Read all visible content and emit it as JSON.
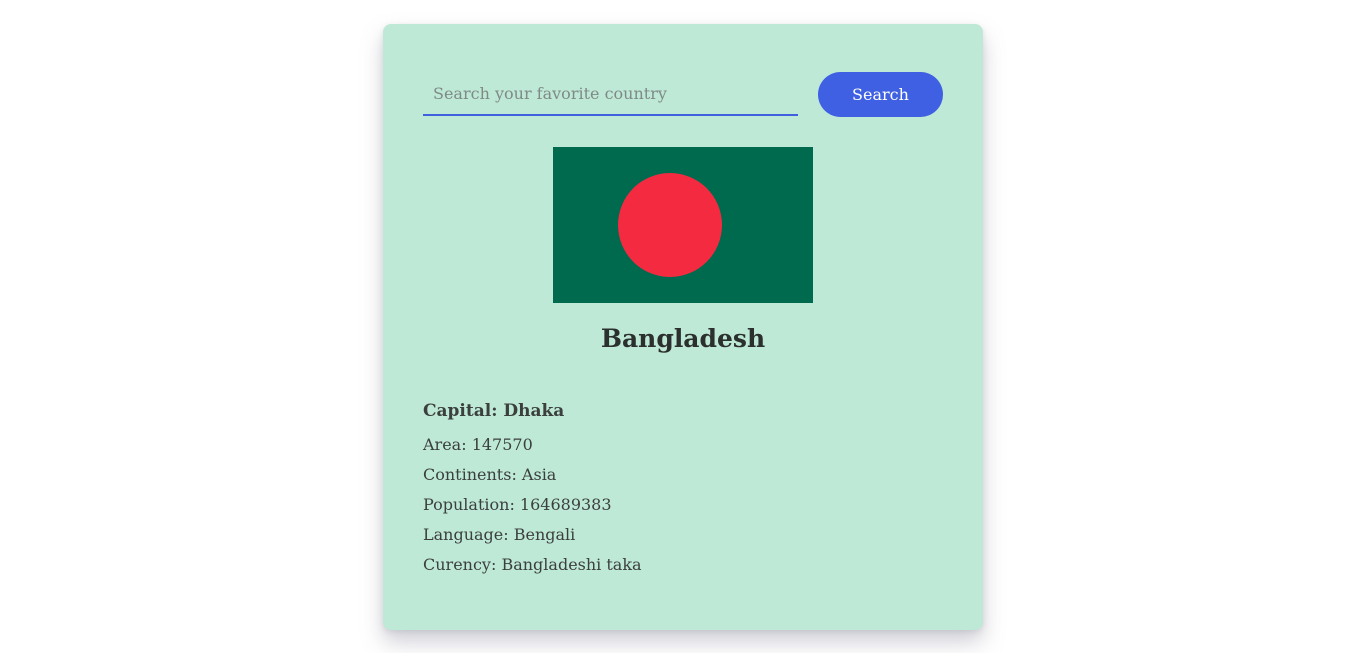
{
  "search": {
    "placeholder": "Search your favorite country",
    "value": "",
    "button_label": "Search"
  },
  "country": {
    "flag": {
      "name": "bangladesh-flag",
      "field_color": "#006a4e",
      "disc_color": "#f42a41"
    },
    "name": "Bangladesh",
    "capital": "Capital: Dhaka",
    "area": "Area: 147570",
    "continents": "Continents: Asia",
    "population": "Population: 164689383",
    "language": "Language: Bengali",
    "currency": "Curency: Bangladeshi taka"
  },
  "colors": {
    "card_background": "#bee9d6",
    "accent": "#3f60e2"
  }
}
